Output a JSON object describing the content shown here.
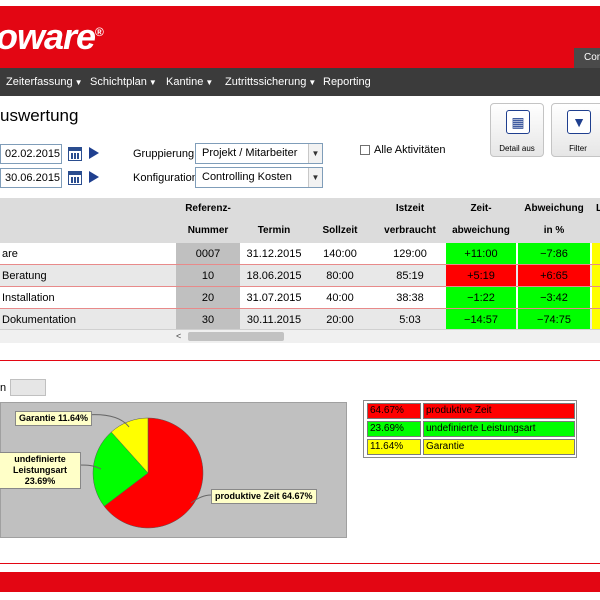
{
  "app": {
    "logo_text": "oware",
    "logo_reg": "®",
    "corner_tab": "Con"
  },
  "nav": {
    "items": [
      {
        "label": "Zeiterfassung",
        "caret": "▼"
      },
      {
        "label": "Schichtplan",
        "caret": "▼"
      },
      {
        "label": "Kantine",
        "caret": "▼"
      },
      {
        "label": "Zutrittssicherung",
        "caret": "▼"
      },
      {
        "label": "Reporting",
        "caret": ""
      }
    ]
  },
  "page": {
    "title": "uswertung"
  },
  "filters": {
    "date_from": "02.02.2015",
    "date_to": "30.06.2015",
    "grouping_label": "Gruppierung",
    "grouping_value": "Projekt / Mitarbeiter",
    "config_label": "Konfiguration",
    "config_value": "Controlling Kosten",
    "all_activities_label": "Alle Aktivitäten",
    "all_activities_checked": false
  },
  "toolbar": {
    "detail_label": "Detail aus",
    "filter_label": "Filter"
  },
  "table": {
    "headers": {
      "ref_line1": "Referenz-",
      "ref_line2": "Nummer",
      "termin": "Termin",
      "sollzeit": "Sollzeit",
      "istzeit_line1": "Istzeit",
      "istzeit_line2": "verbraucht",
      "zeit_line1": "Zeit-",
      "zeit_line2": "abweichung",
      "abw_line1": "Abweichung",
      "abw_line2": "in %",
      "last_partial": "L"
    },
    "rows": [
      {
        "name": "are",
        "ref": "0007",
        "termin": "31.12.2015",
        "soll": "140:00",
        "ist": "129:00",
        "zeit": "+11:00",
        "abw": "−7:86",
        "status": "green"
      },
      {
        "name": "Beratung",
        "ref": "10",
        "termin": "18.06.2015",
        "soll": "80:00",
        "ist": "85:19",
        "zeit": "+5:19",
        "abw": "+6:65",
        "status": "red"
      },
      {
        "name": "Installation",
        "ref": "20",
        "termin": "31.07.2015",
        "soll": "40:00",
        "ist": "38:38",
        "zeit": "−1:22",
        "abw": "−3:42",
        "status": "green"
      },
      {
        "name": "Dokumentation",
        "ref": "30",
        "termin": "30.11.2015",
        "soll": "20:00",
        "ist": "5:03",
        "zeit": "−14:57",
        "abw": "−74:75",
        "status": "green"
      }
    ],
    "scroll_arrow": "<"
  },
  "lower": {
    "filter_label": "n"
  },
  "colors": {
    "brand": "#e30613",
    "nav_bg": "#3b3b3b",
    "green": "#00ff00",
    "red": "#ff0000",
    "yellow": "#ffff00"
  },
  "chart_data": {
    "type": "pie",
    "slices": [
      {
        "label": "produktive Zeit 64.67%",
        "value": 64.67,
        "color": "#ff0000"
      },
      {
        "label": "undefinierte Leistungsart 23.69%",
        "value": 23.69,
        "color": "#00ff00"
      },
      {
        "label": "Garantie 11.64%",
        "value": 11.64,
        "color": "#ffff00"
      }
    ],
    "legend": [
      {
        "value": "64.67%",
        "name": "produktive Zeit",
        "color": "#ff0000"
      },
      {
        "value": "23.69%",
        "name": "undefinierte Leistungsart",
        "color": "#00ff00"
      },
      {
        "value": "11.64%",
        "name": "Garantie",
        "color": "#ffff00"
      }
    ],
    "legend_placement": "right"
  }
}
